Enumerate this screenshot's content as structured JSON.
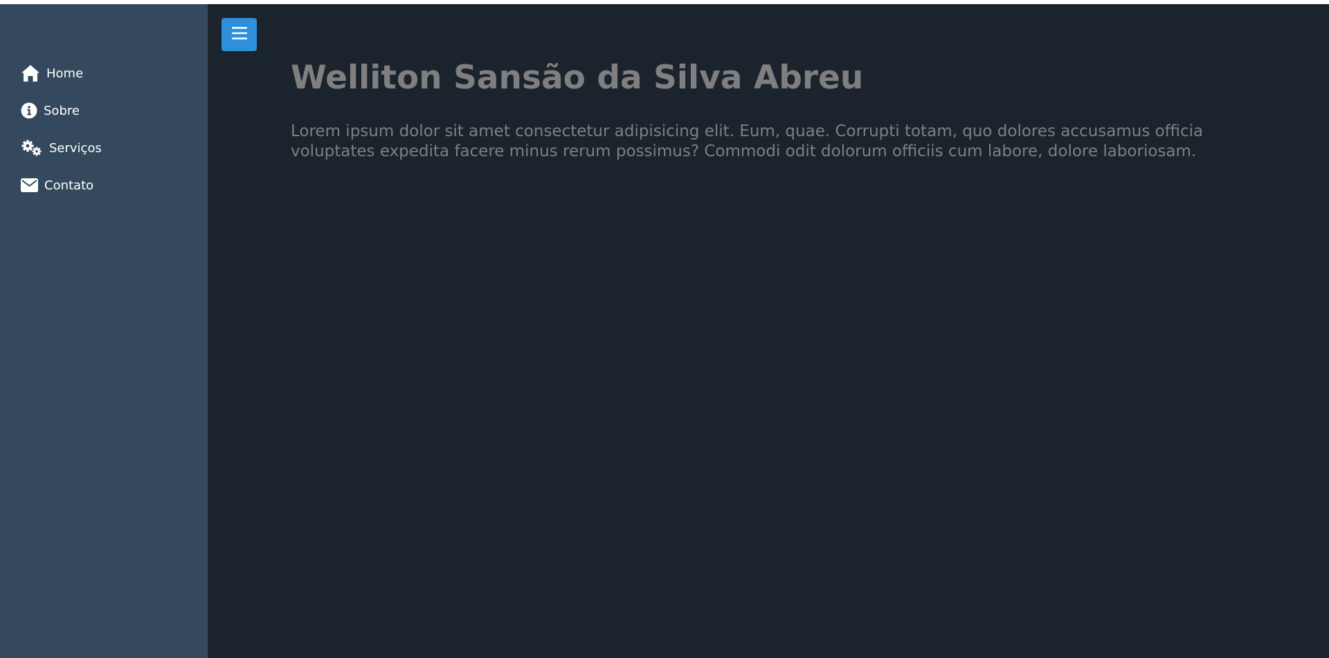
{
  "colors": {
    "sidebar_bg": "#34495e",
    "main_bg": "#1b232d",
    "accent": "#2e8fdb",
    "text_muted": "#7f7f7f",
    "nav_text": "#ffffff"
  },
  "sidebar": {
    "items": [
      {
        "label": "Home",
        "icon": "home-icon"
      },
      {
        "label": "Sobre",
        "icon": "info-circle-icon"
      },
      {
        "label": "Serviços",
        "icon": "gears-icon"
      },
      {
        "label": "Contato",
        "icon": "envelope-icon"
      }
    ]
  },
  "header": {
    "menu_toggle_icon": "hamburger-menu-icon"
  },
  "main": {
    "title": "Welliton Sansão da Silva Abreu",
    "paragraph": "Lorem ipsum dolor sit amet consectetur adipisicing elit. Eum, quae. Corrupti totam, quo dolores accusamus officia voluptates expedita facere minus rerum possimus? Commodi odit dolorum officiis cum labore, dolore laboriosam."
  }
}
